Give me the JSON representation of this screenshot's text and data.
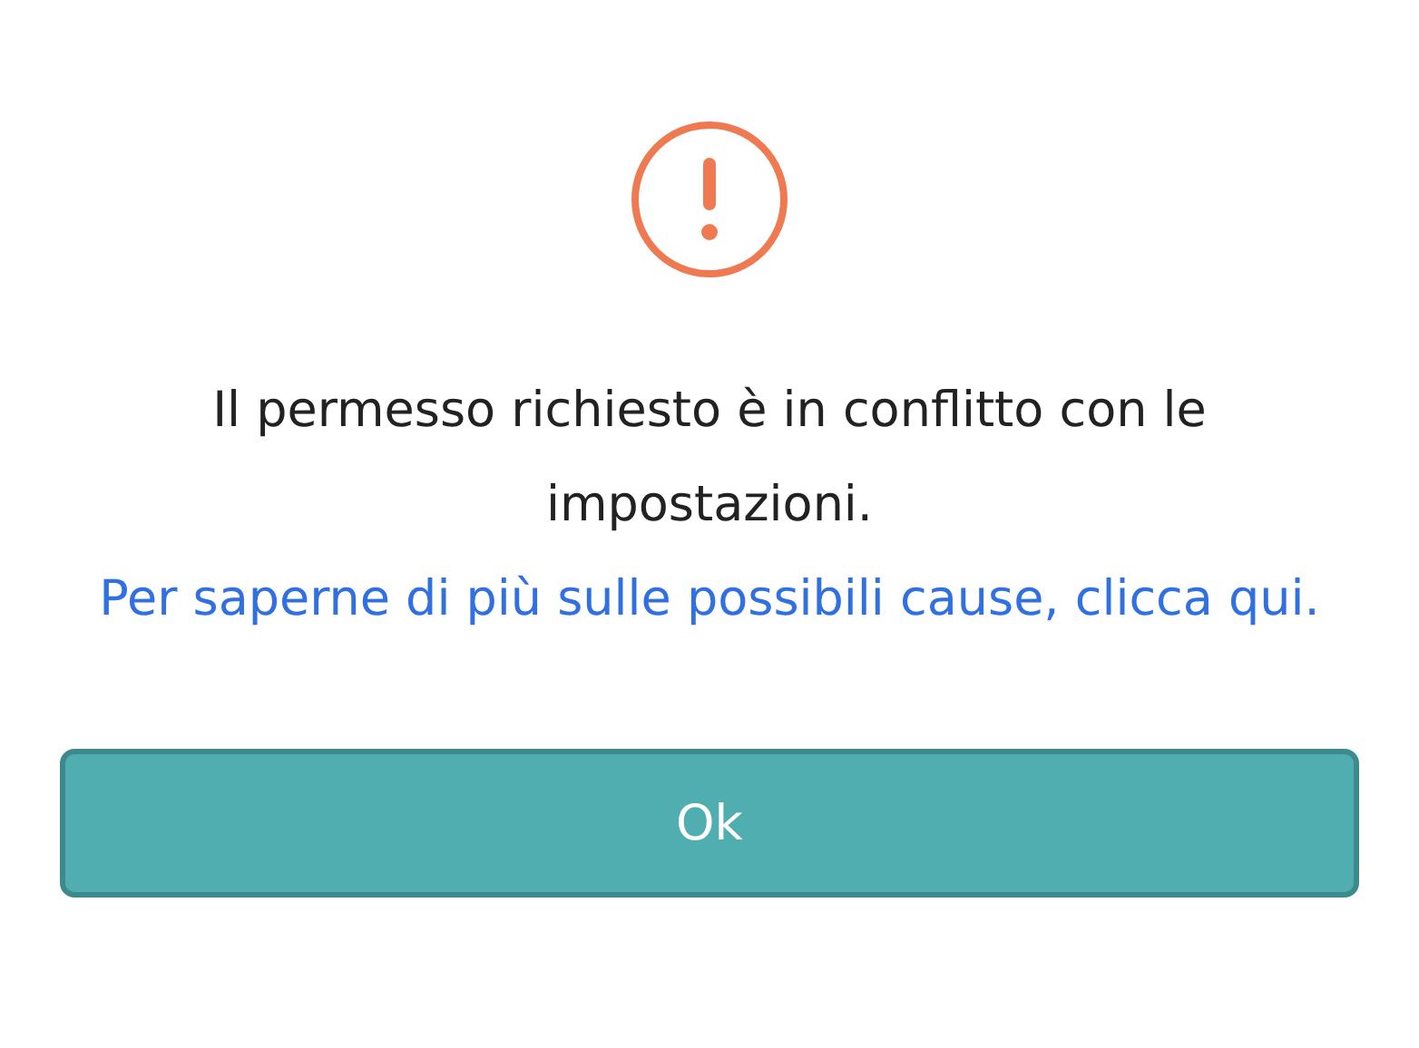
{
  "alert": {
    "message": "Il permesso richiesto è in conflitto con le impostazioni.",
    "link": "Per saperne di più sulle possibili cause, clicca qui.",
    "buttons": [
      {
        "label": "Ok"
      }
    ]
  }
}
